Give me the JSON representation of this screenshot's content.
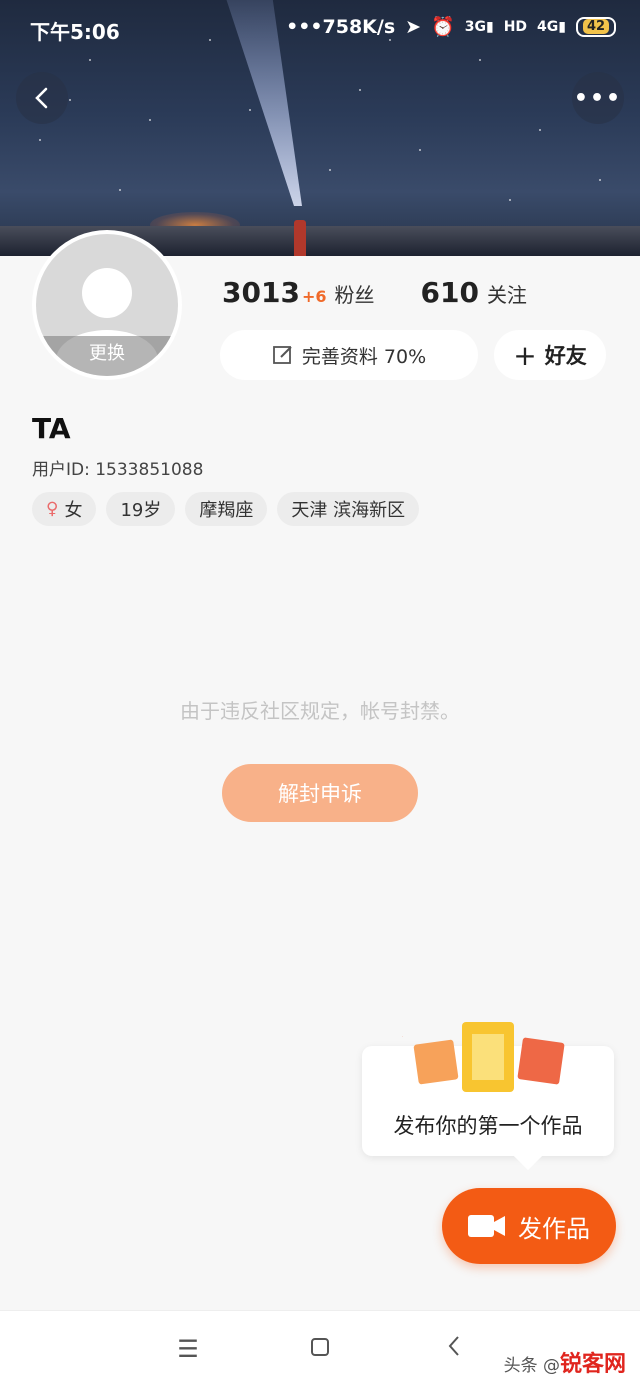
{
  "status_bar": {
    "time": "下午5:06",
    "speed": "•••758K/s",
    "net1": "3G",
    "hd": "HD",
    "net2": "4G",
    "battery": "42"
  },
  "profile": {
    "avatar_change_label": "更换",
    "fans_count": "3013",
    "fans_delta": "+6",
    "fans_label": "粉丝",
    "follow_count": "610",
    "follow_label": "关注",
    "complete_profile_label": "完善资料 70%",
    "add_friend_label": "好友",
    "name": "TA",
    "user_id": "用户ID: 1533851088",
    "tags": [
      "女",
      "19岁",
      "摩羯座",
      "天津 滨海新区"
    ]
  },
  "ban": {
    "message": "由于违反社区规定，帐号封禁。",
    "appeal_label": "解封申诉"
  },
  "tip": {
    "text": "发布你的第一个作品"
  },
  "publish_label": "发作品",
  "watermark": {
    "brand": "锐客网",
    "text": "头条 @"
  },
  "colors": {
    "accent": "#f35b14",
    "appeal": "#f8b189",
    "fans_delta": "#f06a2a"
  }
}
